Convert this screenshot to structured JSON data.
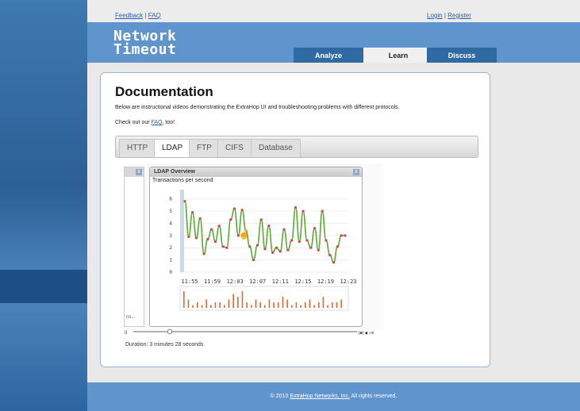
{
  "topbar": {
    "feedback": "Feedback",
    "sep1": "|",
    "faq": "FAQ",
    "login": "Login",
    "sep2": "|",
    "register": "Register"
  },
  "header": {
    "logo_line1": "Network",
    "logo_line2": "Timeout",
    "tabs": [
      {
        "label": "Analyze",
        "active": false
      },
      {
        "label": "Learn",
        "active": true
      },
      {
        "label": "Discuss",
        "active": false
      }
    ]
  },
  "main": {
    "title": "Documentation",
    "intro": "Below are instructional videos demonstrating the ExtraHop UI and troubleshooting problems with different protocols.",
    "faq_prefix": "Check out our",
    "faq_link": "FAQ",
    "faq_suffix": ", too!",
    "protocol_tabs": [
      {
        "label": "HTTP",
        "active": false
      },
      {
        "label": "LDAP",
        "active": true
      },
      {
        "label": "FTP",
        "active": false
      },
      {
        "label": "CIFS",
        "active": false
      },
      {
        "label": "Database",
        "active": false
      }
    ],
    "duration": "Duration: 3 minutes 28 seconds"
  },
  "video": {
    "window_title": "LDAP Overview",
    "close_glyph": "x",
    "subtitle": "Transactions per second",
    "left_panel_text": "ns...",
    "pause_glyph": "II",
    "controls_glyph": "[■] ◀ ·ıııl",
    "line_color": "#5aa832",
    "point_color": "#d24848",
    "bar_color": "#d96a3a",
    "chart_data": {
      "type": "line",
      "xticks": [
        "11:55",
        "11:59",
        "12:03",
        "12:07",
        "12:11",
        "12:15",
        "12:19",
        "12:23"
      ],
      "yticks": [
        "0",
        "1",
        "2",
        "3",
        "4",
        "5",
        "6"
      ],
      "ylim": [
        0,
        6.5
      ],
      "values": [
        5.8,
        2.9,
        4.9,
        2.8,
        4.4,
        1.5,
        2.7,
        3.5,
        2.5,
        3.8,
        2.1,
        2.0,
        4.3,
        5.2,
        3.0,
        5.1,
        3.4,
        2.1,
        1.0,
        2.2,
        4.3,
        1.9,
        3.8,
        1.6,
        2.0,
        1.7,
        3.5,
        1.8,
        2.6,
        5.3,
        2.5,
        5.0,
        2.6,
        2.0,
        3.6,
        1.8,
        5.0,
        2.6,
        1.4,
        0.8,
        2.1,
        3.0,
        3.0
      ],
      "bars": [
        6,
        3,
        1,
        2,
        1,
        3,
        1,
        2,
        2,
        1,
        3,
        5,
        4,
        6,
        2,
        1,
        3,
        2,
        1,
        3,
        2,
        2,
        4,
        3,
        1,
        2,
        1,
        2,
        3,
        1,
        2,
        4,
        1,
        2,
        2,
        3
      ]
    }
  },
  "footer": {
    "prefix": "© 2010",
    "link": "ExtraHop Networks, Inc.",
    "suffix": " All rights reserved."
  }
}
